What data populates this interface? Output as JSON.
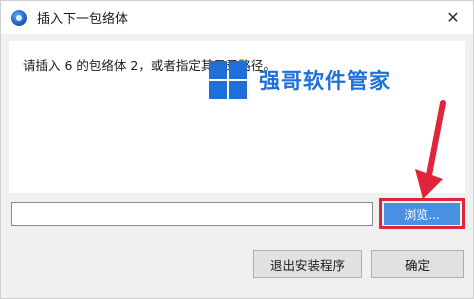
{
  "window": {
    "title": "插入下一包络体",
    "close_glyph": "✕"
  },
  "dialog": {
    "message": "请插入 6 的包络体 2，或者指定其目录路径。",
    "path_value": "",
    "browse_label": "浏览...",
    "exit_setup_label": "退出安装程序",
    "ok_label": "确定"
  },
  "watermark": {
    "text": "强哥软件管家",
    "color": "#1e6fd9"
  },
  "colors": {
    "highlight_red": "#e0253a",
    "browse_blue": "#4a90e2"
  }
}
